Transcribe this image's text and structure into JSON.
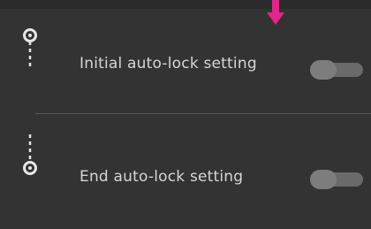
{
  "settings": {
    "items": [
      {
        "label": "Initial auto-lock setting",
        "icon": "initial-lock-icon",
        "enabled": false
      },
      {
        "label": "End auto-lock setting",
        "icon": "end-lock-icon",
        "enabled": false
      }
    ]
  },
  "colors": {
    "background": "#333333",
    "text": "#d6d6d6",
    "pointer": "#e0278a"
  }
}
